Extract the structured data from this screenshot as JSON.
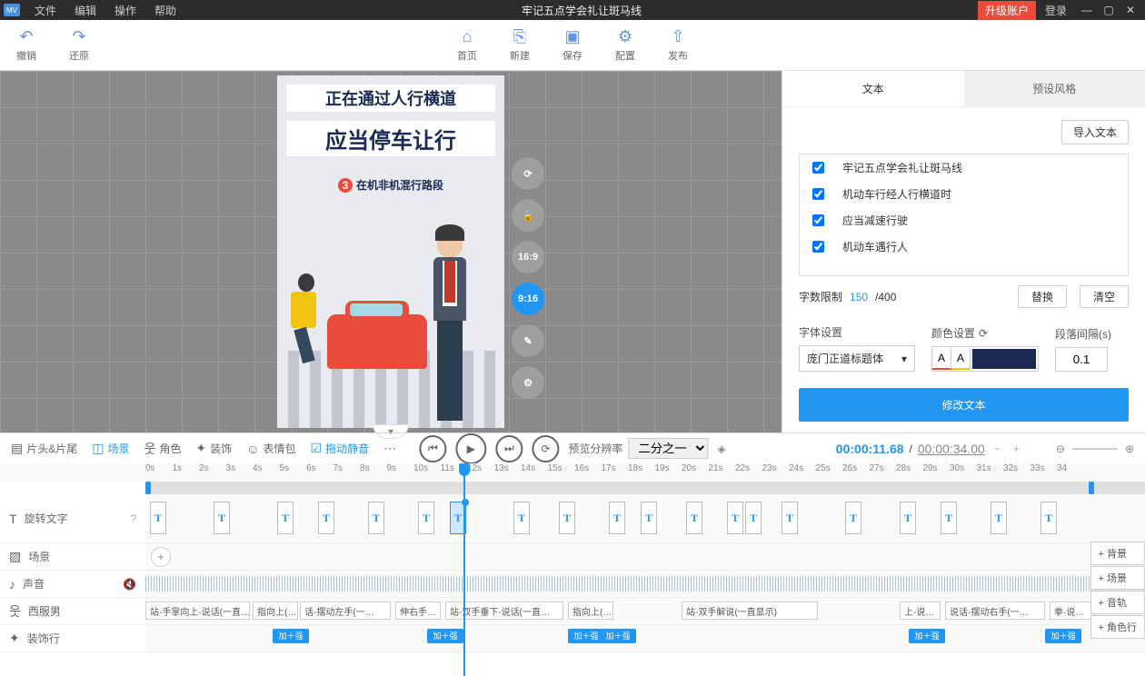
{
  "titlebar": {
    "logo": "MV",
    "menus": [
      "文件",
      "编辑",
      "操作",
      "帮助"
    ],
    "title": "牢记五点学会礼让斑马线",
    "upgrade": "升级账户",
    "login": "登录"
  },
  "toolbar": {
    "undo": "撤销",
    "redo": "还原",
    "home": "首页",
    "new": "新建",
    "save": "保存",
    "config": "配置",
    "publish": "发布"
  },
  "canvas": {
    "text1": "正在通过人行横道",
    "text2": "应当停车让行",
    "text3_num": "3",
    "text3": "在机非机混行路段",
    "ratios": {
      "r1": "16:9",
      "r2": "9:16"
    }
  },
  "right": {
    "tab1": "文本",
    "tab2": "预设风格",
    "import": "导入文本",
    "items": [
      "牢记五点学会礼让斑马线",
      "机动车行经人行横道时",
      "应当减速行驶",
      "机动车遇行人"
    ],
    "limit_lbl": "字数限制",
    "limit_cur": "150",
    "limit_max": " /400",
    "replace": "替换",
    "clear": "清空",
    "font_lbl": "字体设置",
    "font_val": "庞门正道标题体",
    "color_lbl": "颜色设置",
    "colorA": "A",
    "colorA2": "A",
    "interval_lbl": "段落间隔(s)",
    "interval_val": "0.1",
    "modify": "修改文本"
  },
  "th": {
    "head_tail": "片头&片尾",
    "scene": "场景",
    "role": "角色",
    "deco": "装饰",
    "emoji": "表情包",
    "drag_mute": "拖动静音",
    "preview_lbl": "预览分辨率",
    "preview_val": "二分之一",
    "time_cur": "00:00:11.68",
    "time_sep": "/",
    "time_total": "00:00:34.00"
  },
  "tracks": {
    "rotate_text": "旋转文字",
    "scene": "场景",
    "sound": "声音",
    "man": "西服男",
    "deco_row": "装饰行",
    "add_bg": "+ 背景",
    "add_scene": "+ 场景",
    "add_audio": "+ 音轨",
    "add_role": "+ 角色行",
    "actions": [
      "站-手掌向上-说话(一直…",
      "指向上(…",
      "话-摆动左手(一…",
      "伸右手…",
      "站-双手垂下-说话(一直…",
      "指向上(…",
      "站-双手解说(一直显示)",
      "上-说…",
      "说话-摆动右手(一…",
      "拳-说…"
    ],
    "deco_lbl": "加＋强"
  },
  "ruler": [
    "0s",
    "1s",
    "2s",
    "3s",
    "4s",
    "5s",
    "6s",
    "7s",
    "8s",
    "9s",
    "10s",
    "11s",
    "12s",
    "13s",
    "14s",
    "15s",
    "16s",
    "17s",
    "18s",
    "19s",
    "20s",
    "21s",
    "22s",
    "23s",
    "24s",
    "25s",
    "26s",
    "27s",
    "28s",
    "29s",
    "30s",
    "31s",
    "32s",
    "33s",
    "34"
  ]
}
